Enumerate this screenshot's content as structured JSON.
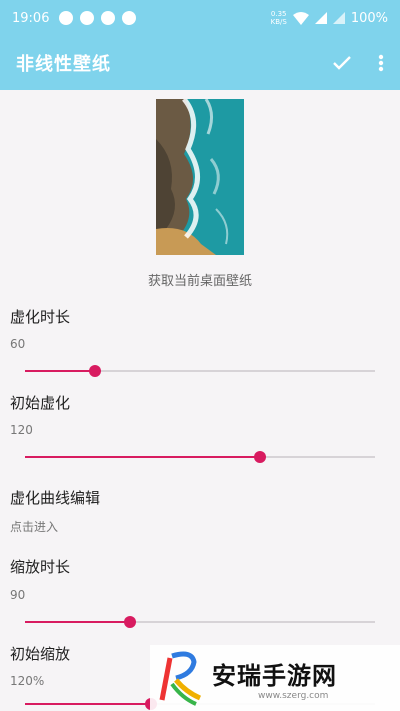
{
  "status_bar": {
    "time": "19:06",
    "net_speed_value": "0.35",
    "net_speed_unit": "KB/S",
    "battery": "100%"
  },
  "app_bar": {
    "title": "非线性壁纸",
    "confirm_icon": "check-icon",
    "menu_icon": "more-vertical-icon"
  },
  "preview": {
    "caption": "获取当前桌面壁纸"
  },
  "settings": [
    {
      "title": "虚化时长",
      "value": "60",
      "slider_fraction": 0.2
    },
    {
      "title": "初始虚化",
      "value": "120",
      "slider_fraction": 0.67
    },
    {
      "title": "虚化曲线编辑",
      "value": "点击进入"
    },
    {
      "title": "缩放时长",
      "value": "90",
      "slider_fraction": 0.3
    },
    {
      "title": "初始缩放",
      "value": "120%",
      "slider_fraction": 0.36
    }
  ],
  "watermark": {
    "name": "安瑞手游网",
    "url": "www.szerg.com"
  },
  "colors": {
    "app_bar": "#7fd3ec",
    "accent": "#d81b60",
    "track": "#d7d3d7",
    "background": "#f6f4f6"
  }
}
